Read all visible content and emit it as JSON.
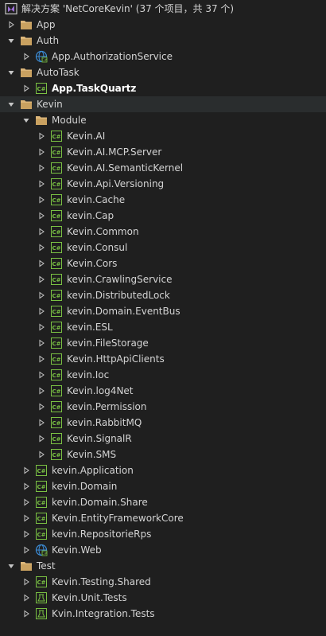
{
  "solution": {
    "label": "解决方案 'NetCoreKevin' (37 个项目，共 37 个)",
    "icon": "visual-studio-solution-icon"
  },
  "colors": {
    "background": "#1f1f1f",
    "text": "#d4d4d4",
    "folder": "#dcb67a",
    "csproj": "#7ac143",
    "webproj": "#3c8dd8",
    "arrow": "#c5c5c5"
  },
  "items": [
    {
      "label": "App",
      "kind": "folder",
      "expanded": false
    },
    {
      "label": "Auth",
      "kind": "folder",
      "expanded": true
    },
    {
      "label": "App.AuthorizationService",
      "kind": "web",
      "expanded": false
    },
    {
      "label": "AutoTask",
      "kind": "folder",
      "expanded": true
    },
    {
      "label": "App.TaskQuartz",
      "kind": "csproj",
      "expanded": false,
      "bold": true
    },
    {
      "label": "Kevin",
      "kind": "folder",
      "expanded": true
    },
    {
      "label": "Module",
      "kind": "folder",
      "expanded": true
    },
    {
      "label": "Kevin.AI",
      "kind": "csproj",
      "expanded": false
    },
    {
      "label": "Kevin.AI.MCP.Server",
      "kind": "csproj",
      "expanded": false
    },
    {
      "label": "Kevin.AI.SemanticKernel",
      "kind": "csproj",
      "expanded": false
    },
    {
      "label": "Kevin.Api.Versioning",
      "kind": "csproj",
      "expanded": false
    },
    {
      "label": "kevin.Cache",
      "kind": "csproj",
      "expanded": false
    },
    {
      "label": "kevin.Cap",
      "kind": "csproj",
      "expanded": false
    },
    {
      "label": "Kevin.Common",
      "kind": "csproj",
      "expanded": false
    },
    {
      "label": "kevin.Consul",
      "kind": "csproj",
      "expanded": false
    },
    {
      "label": "Kevin.Cors",
      "kind": "csproj",
      "expanded": false
    },
    {
      "label": "kevin.CrawlingService",
      "kind": "csproj",
      "expanded": false
    },
    {
      "label": "kevin.DistributedLock",
      "kind": "csproj",
      "expanded": false
    },
    {
      "label": "kevin.Domain.EventBus",
      "kind": "csproj",
      "expanded": false
    },
    {
      "label": "kevin.ESL",
      "kind": "csproj",
      "expanded": false
    },
    {
      "label": "kevin.FileStorage",
      "kind": "csproj",
      "expanded": false
    },
    {
      "label": "Kevin.HttpApiClients",
      "kind": "csproj",
      "expanded": false
    },
    {
      "label": "kevin.Ioc",
      "kind": "csproj",
      "expanded": false
    },
    {
      "label": "Kevin.log4Net",
      "kind": "csproj",
      "expanded": false
    },
    {
      "label": "kevin.Permission",
      "kind": "csproj",
      "expanded": false
    },
    {
      "label": "kevin.RabbitMQ",
      "kind": "csproj",
      "expanded": false
    },
    {
      "label": "Kevin.SignalR",
      "kind": "csproj",
      "expanded": false
    },
    {
      "label": "Kevin.SMS",
      "kind": "csproj",
      "expanded": false
    },
    {
      "label": "kevin.Application",
      "kind": "csproj",
      "expanded": false
    },
    {
      "label": "kevin.Domain",
      "kind": "csproj",
      "expanded": false
    },
    {
      "label": "kevin.Domain.Share",
      "kind": "csproj",
      "expanded": false
    },
    {
      "label": "Kevin.EntityFrameworkCore",
      "kind": "csproj",
      "expanded": false
    },
    {
      "label": "kevin.RepositorieRps",
      "kind": "csproj",
      "expanded": false
    },
    {
      "label": "Kevin.Web",
      "kind": "web",
      "expanded": false
    },
    {
      "label": "Test",
      "kind": "folder",
      "expanded": true
    },
    {
      "label": "Kevin.Testing.Shared",
      "kind": "csproj",
      "expanded": false
    },
    {
      "label": "Kevin.Unit.Tests",
      "kind": "test",
      "expanded": false
    },
    {
      "label": "Kvin.Integration.Tests",
      "kind": "test",
      "expanded": false
    }
  ]
}
